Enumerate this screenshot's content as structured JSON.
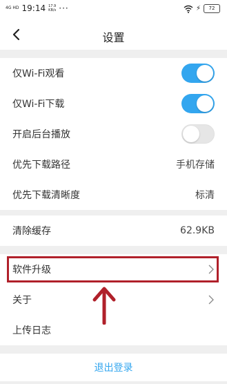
{
  "status_bar": {
    "signal": "4G HD",
    "time": "19:14",
    "speed_value": "17.9",
    "speed_unit": "KB/s",
    "dots": "···",
    "battery": "72"
  },
  "header": {
    "title": "设置"
  },
  "settings": {
    "wifi_watch": {
      "label": "仅Wi-Fi观看",
      "enabled": true
    },
    "wifi_download": {
      "label": "仅Wi-Fi下载",
      "enabled": true
    },
    "background_play": {
      "label": "开启后台播放",
      "enabled": false
    },
    "download_path": {
      "label": "优先下载路径",
      "value": "手机存储"
    },
    "download_quality": {
      "label": "优先下载清晰度",
      "value": "标清"
    }
  },
  "cache": {
    "label": "清除缓存",
    "value": "62.9KB"
  },
  "misc": {
    "upgrade": {
      "label": "软件升级"
    },
    "about": {
      "label": "关于"
    },
    "upload_log": {
      "label": "上传日志"
    }
  },
  "logout": {
    "label": "退出登录"
  },
  "colors": {
    "accent": "#33a6ef",
    "annotation": "#b0202a"
  }
}
